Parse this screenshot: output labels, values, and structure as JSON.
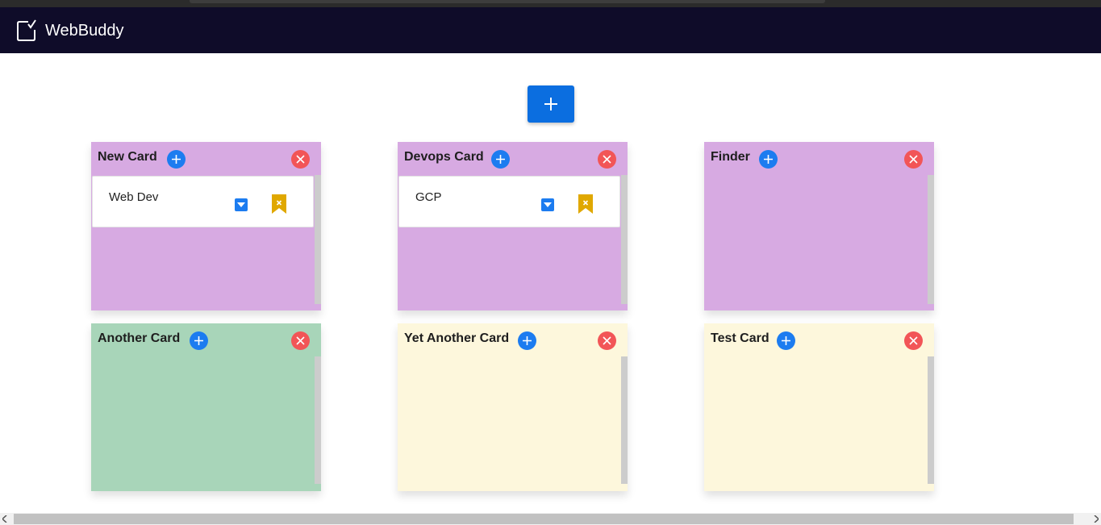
{
  "app": {
    "title": "WebBuddy"
  },
  "toolbar": {
    "add_board_icon": "plus-icon"
  },
  "colors": {
    "navbar": "#0f0c29",
    "primary": "#1c7cf0",
    "danger": "#f25557",
    "bookmark": "#e0a800",
    "purple_card": "#d7aae2",
    "green_card": "#a8d5b9",
    "yellow_card": "#fdf7dc"
  },
  "cards": [
    {
      "title": "New Card",
      "color": "#d7aae2",
      "items": [
        {
          "text": "Web Dev"
        }
      ]
    },
    {
      "title": "Devops Card",
      "color": "#d7aae2",
      "items": [
        {
          "text": "GCP"
        }
      ]
    },
    {
      "title": "Finder",
      "color": "#d7aae2",
      "items": []
    },
    {
      "title": "Another Card",
      "color": "#a8d5b9",
      "items": []
    },
    {
      "title": "Yet Another Card",
      "color": "#fdf7dc",
      "items": []
    },
    {
      "title": "Test Card",
      "color": "#fdf7dc",
      "items": []
    }
  ]
}
